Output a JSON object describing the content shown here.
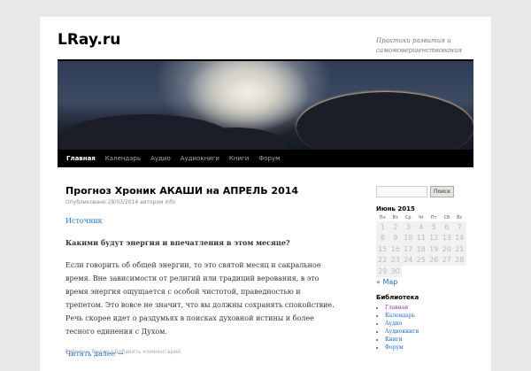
{
  "site": {
    "title": "LRay.ru",
    "description": "Практики развития и самомовершенствования"
  },
  "nav": [
    "Главная",
    "Календарь",
    "Аудио",
    "Аудиокниги",
    "Книги",
    "Форум"
  ],
  "post": {
    "title": "Прогноз Хроник АКАШИ на АПРЕЛЬ 2014",
    "meta_prefix": "Опубликовано",
    "date": "28/03/2014",
    "meta_by": "автором",
    "author": "info",
    "source_link": "Источник",
    "subtitle": "Какими будут энергия и впечатления в этом месяце?",
    "body": "Если говорить об общей энергии, то это святой месяц и сакральное время. Вне зависимости от религий или традиций верования, в это время энергия ощущается с особой чистотой, праведностью и трепетом. Это вовсе не значит, что вы должны сохранять спокойствие. Речь скорее идет о раздумьях в поисках духовной истины и более тесного единения с Духом.",
    "read_more": "Читать далее →",
    "footer": "Рубрика: Видео | Добавить комментарий"
  },
  "sidebar": {
    "search_button": "Поиск",
    "calendar_title": "Июнь 2015",
    "weekdays": [
      "Пн",
      "Вт",
      "Ср",
      "Чт",
      "Пт",
      "Сб",
      "Вс"
    ],
    "weeks": [
      [
        "1",
        "2",
        "3",
        "4",
        "5",
        "6",
        "7"
      ],
      [
        "8",
        "9",
        "10",
        "11",
        "12",
        "13",
        "14"
      ],
      [
        "15",
        "16",
        "17",
        "18",
        "19",
        "20",
        "21"
      ],
      [
        "22",
        "23",
        "24",
        "25",
        "26",
        "27",
        "28"
      ],
      [
        "29",
        "30"
      ]
    ],
    "prev": "« Мар",
    "library_title": "Библиотека",
    "library": [
      "Главная",
      "Календарь",
      "Аудио",
      "Аудиокниги",
      "Книги",
      "Форум"
    ]
  }
}
